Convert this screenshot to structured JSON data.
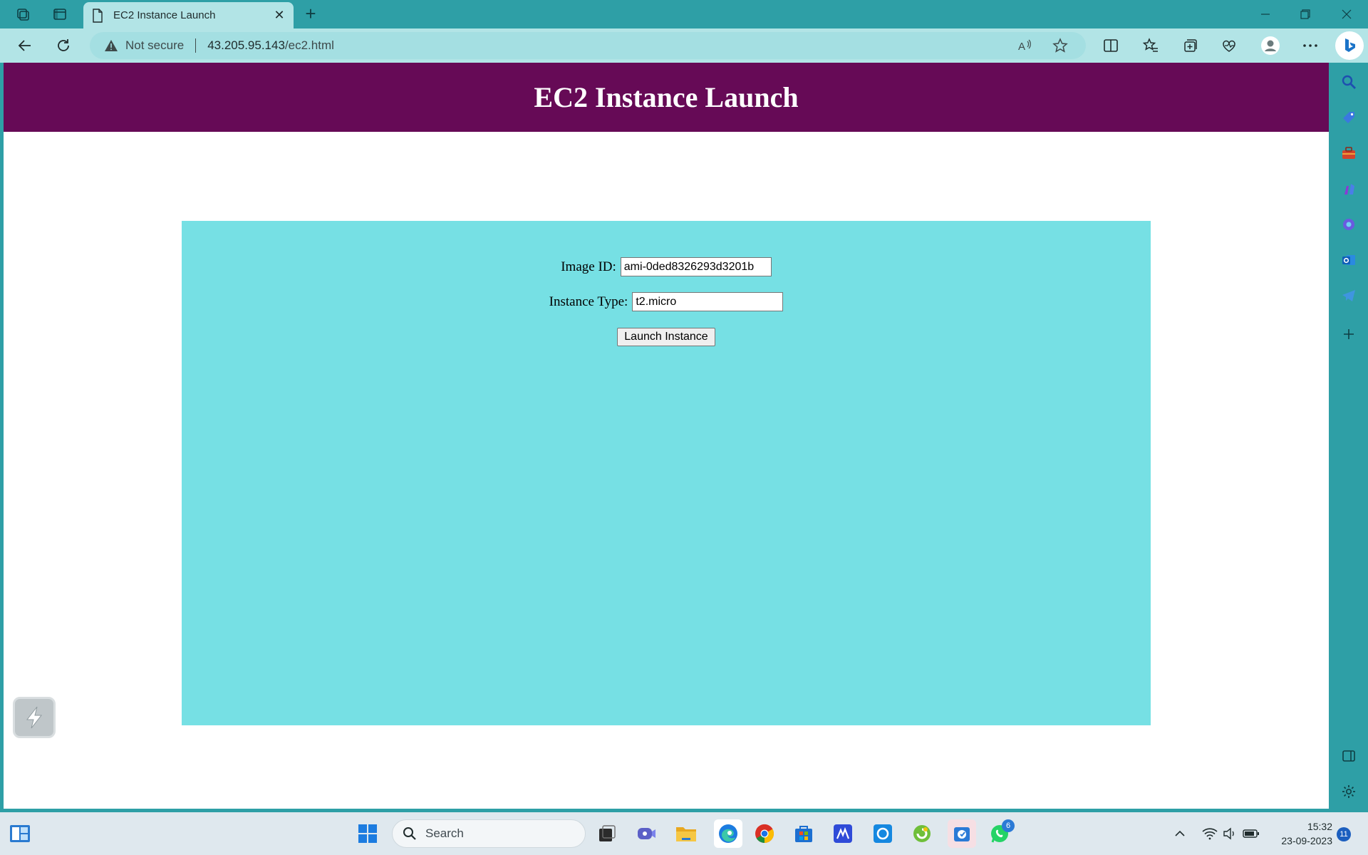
{
  "browser": {
    "tab_title": "EC2 Instance Launch",
    "security_label": "Not secure",
    "url_host": "43.205.95.143",
    "url_path": "/ec2.html"
  },
  "page": {
    "heading": "EC2 Instance Launch",
    "form": {
      "image_id_label": "Image ID:",
      "image_id_value": "ami-0ded8326293d3201b",
      "instance_type_label": "Instance Type:",
      "instance_type_value": "t2.micro",
      "submit_label": "Launch Instance"
    },
    "colors": {
      "header_bg": "#660a56",
      "panel_bg": "#76e0e4",
      "browser_accent": "#2e9fa6"
    }
  },
  "sidebar": {
    "icons": [
      "search-icon",
      "shopping-tag-icon",
      "toolbox-icon",
      "games-icon",
      "copilot-icon",
      "outlook-icon",
      "telegram-icon",
      "add-icon",
      "split-pane-icon",
      "settings-icon"
    ]
  },
  "taskbar": {
    "search_placeholder": "Search",
    "time": "15:32",
    "date": "23-09-2023",
    "whatsapp_badge": "6",
    "notification_count": "11",
    "pinned_apps": [
      "start-icon",
      "search-icon",
      "task-view-icon",
      "teams-icon",
      "file-explorer-icon",
      "edge-icon",
      "chrome-icon",
      "microsoft-store-icon",
      "vscode-icon",
      "cortana-icon",
      "app-icon",
      "snipping-tool-icon",
      "whatsapp-icon"
    ]
  }
}
